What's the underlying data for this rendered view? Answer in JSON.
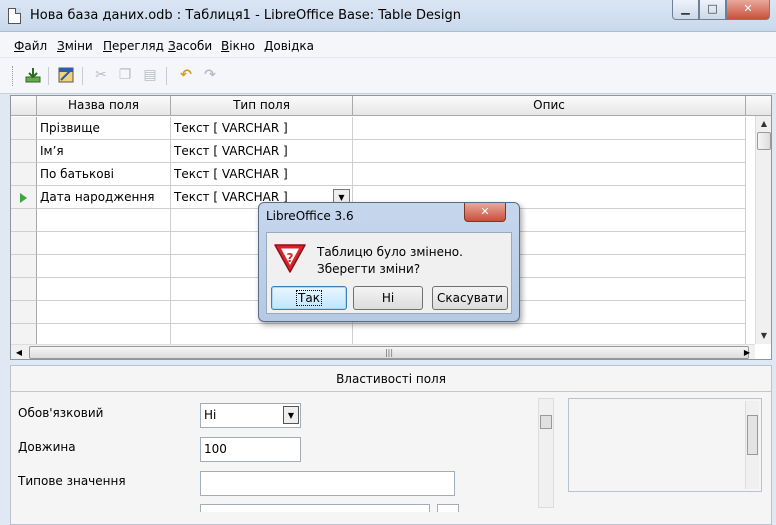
{
  "window": {
    "title": "Нова база даних.odb : Таблиця1 - LibreOffice Base: Table Design",
    "min_glyph": "▁",
    "max_glyph": "□",
    "close_glyph": "✕"
  },
  "menu": [
    {
      "access": "Ф",
      "rest": "айл"
    },
    {
      "access": "З",
      "rest": "міни"
    },
    {
      "access": "П",
      "rest": "ерегляд"
    },
    {
      "access": "З",
      "rest": "асоби"
    },
    {
      "access": "В",
      "rest": "ікно"
    },
    {
      "access": "Д",
      "rest": "овідка"
    }
  ],
  "toolbar": {
    "icons": [
      "save-icon",
      "design-icon",
      "cut-icon",
      "copy-icon",
      "paste-icon",
      "undo-icon",
      "redo-icon"
    ]
  },
  "grid": {
    "headers": [
      "Назва поля",
      "Тип поля",
      "Опис"
    ],
    "rows": [
      {
        "name": "Прізвище",
        "type": "Текст [ VARCHAR ]",
        "desc": ""
      },
      {
        "name": "Ім’я",
        "type": "Текст [ VARCHAR ]",
        "desc": ""
      },
      {
        "name": "По батькові",
        "type": "Текст [ VARCHAR ]",
        "desc": ""
      },
      {
        "name": "Дата народження",
        "type": "Текст [ VARCHAR ]",
        "desc": ""
      }
    ],
    "current_row_index": 3
  },
  "properties": {
    "title": "Властивості поля",
    "required": {
      "label": "Обов'язковий",
      "value": "Ні"
    },
    "length": {
      "label": "Довжина",
      "value": "100"
    },
    "default": {
      "label": "Типове значення",
      "value": ""
    }
  },
  "dialog": {
    "title": "LibreOffice 3.6",
    "close_glyph": "✕",
    "message_line1": "Таблицю було змінено.",
    "message_line2": "Зберегти зміни?",
    "icon": "warning-icon",
    "buttons": {
      "yes": "Так",
      "no": "Ні",
      "cancel": "Скасувати"
    }
  },
  "colors": {
    "warning_red": "#d8232a",
    "current_row_marker": "#3da83d",
    "titlebar": "#c9d9ec"
  }
}
